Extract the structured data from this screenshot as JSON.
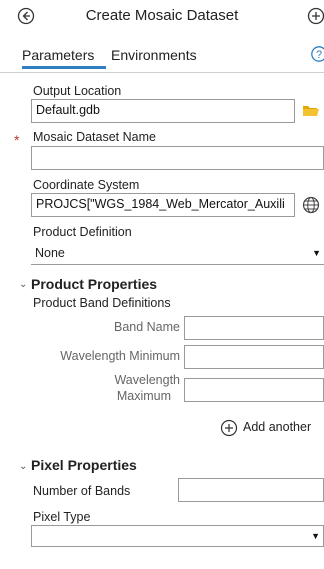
{
  "header": {
    "title": "Create Mosaic Dataset"
  },
  "tabs": [
    {
      "label": "Parameters"
    },
    {
      "label": "Environments"
    }
  ],
  "help_label": "?",
  "output_location": {
    "label": "Output Location",
    "value": "Default.gdb"
  },
  "mosaic_name": {
    "label": "Mosaic Dataset Name",
    "value": ""
  },
  "coordinate_system": {
    "label": "Coordinate System",
    "value": "PROJCS[\"WGS_1984_Web_Mercator_Auxili"
  },
  "product_definition": {
    "label": "Product Definition",
    "value": "None"
  },
  "product_properties": {
    "heading": "Product Properties",
    "subheading": "Product Band Definitions",
    "band_name_label": "Band Name",
    "wavelength_min_label": "Wavelength Minimum",
    "wavelength_max_label_line1": "Wavelength",
    "wavelength_max_label_line2": "Maximum",
    "add_another_label": "Add another"
  },
  "pixel_properties": {
    "heading": "Pixel Properties",
    "number_of_bands_label": "Number of Bands",
    "pixel_type_label": "Pixel Type",
    "pixel_type_value": ""
  },
  "colors": {
    "accent": "#2f7fc1",
    "folder": "#e0a800",
    "required": "#c0392b"
  }
}
